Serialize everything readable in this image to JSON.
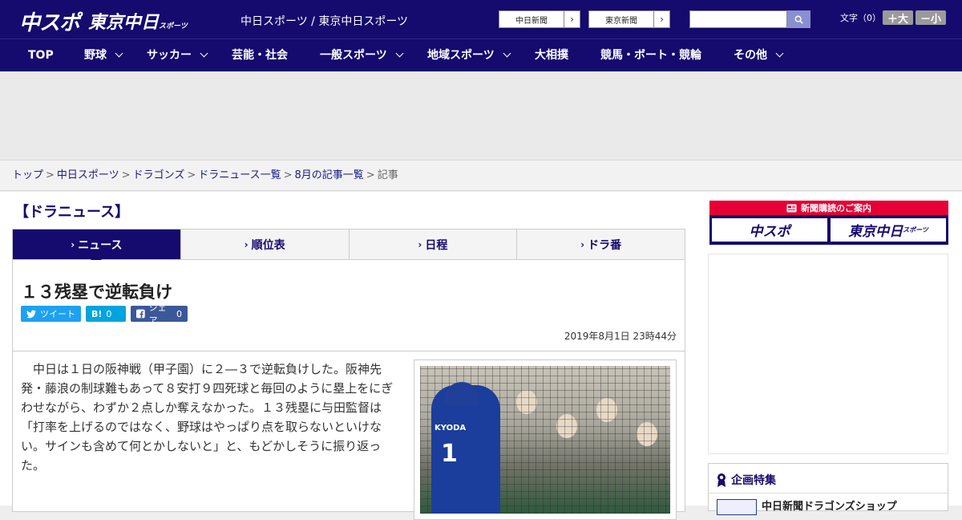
{
  "header": {
    "logo_chuspo": "中スポ",
    "logo_tokyo": "東京中日",
    "logo_tokyo_small": "スポーツ",
    "site_sub": "中日スポーツ / 東京中日スポーツ",
    "link_chunichi": "中日新聞",
    "link_tokyo": "東京新聞",
    "search_placeholder": "",
    "font_label": "文字（0）",
    "font_bigger": "＋大",
    "font_smaller": "－小"
  },
  "nav": {
    "items": [
      {
        "label": "TOP"
      },
      {
        "label": "野球"
      },
      {
        "label": "サッカー"
      },
      {
        "label": "芸能・社会"
      },
      {
        "label": "一般スポーツ"
      },
      {
        "label": "地域スポーツ"
      },
      {
        "label": "大相撲"
      },
      {
        "label": "競馬・ボート・競輪"
      },
      {
        "label": "その他"
      }
    ]
  },
  "breadcrumb": {
    "items": [
      "トップ",
      "中日スポーツ",
      "ドラゴンズ",
      "ドラニュース一覧",
      "8月の記事一覧"
    ],
    "current": "記事"
  },
  "section_title": "【ドラニュース】",
  "tabs": [
    {
      "label": "ニュース",
      "active": true
    },
    {
      "label": "順位表"
    },
    {
      "label": "日程"
    },
    {
      "label": "ドラ番"
    }
  ],
  "article": {
    "headline": "１３残塁で逆転負け",
    "share_tweet": "ツイート",
    "share_hatena_icon": "B!",
    "share_hatena_count": "0",
    "share_fb_label": "シェア",
    "share_fb_count": "0",
    "date": "2019年8月1日 23時44分",
    "body": "中日は１日の阪神戦（甲子園）に２―３で逆転負けした。阪神先発・藤浪の制球難もあって８安打９四死球と毎回のように塁上をにぎわせながら、わずか２点しか奪えなかった。１３残塁に与田監督は「打率を上げるのではなく、野球はやっぱり点を取らないといけない。サインも含めて何とかしないと」と、もどかしそうに振り返った。",
    "photo_jersey_name": "KYODA",
    "photo_jersey_number": "1"
  },
  "sidebar": {
    "banner_title": "新聞購読のご案内",
    "banner_logo_chuspo": "中スポ",
    "banner_logo_tokyo": "東京中日",
    "banner_logo_tokyo_small": "スポーツ",
    "feature_title": "企画特集",
    "feature_item": "中日新聞ドラゴンズショップ"
  },
  "colors": {
    "brand_navy": "#150a6e",
    "banner_red": "#e60033",
    "twitter": "#1da1f2",
    "hatena": "#00a4de",
    "facebook": "#3b5998"
  }
}
